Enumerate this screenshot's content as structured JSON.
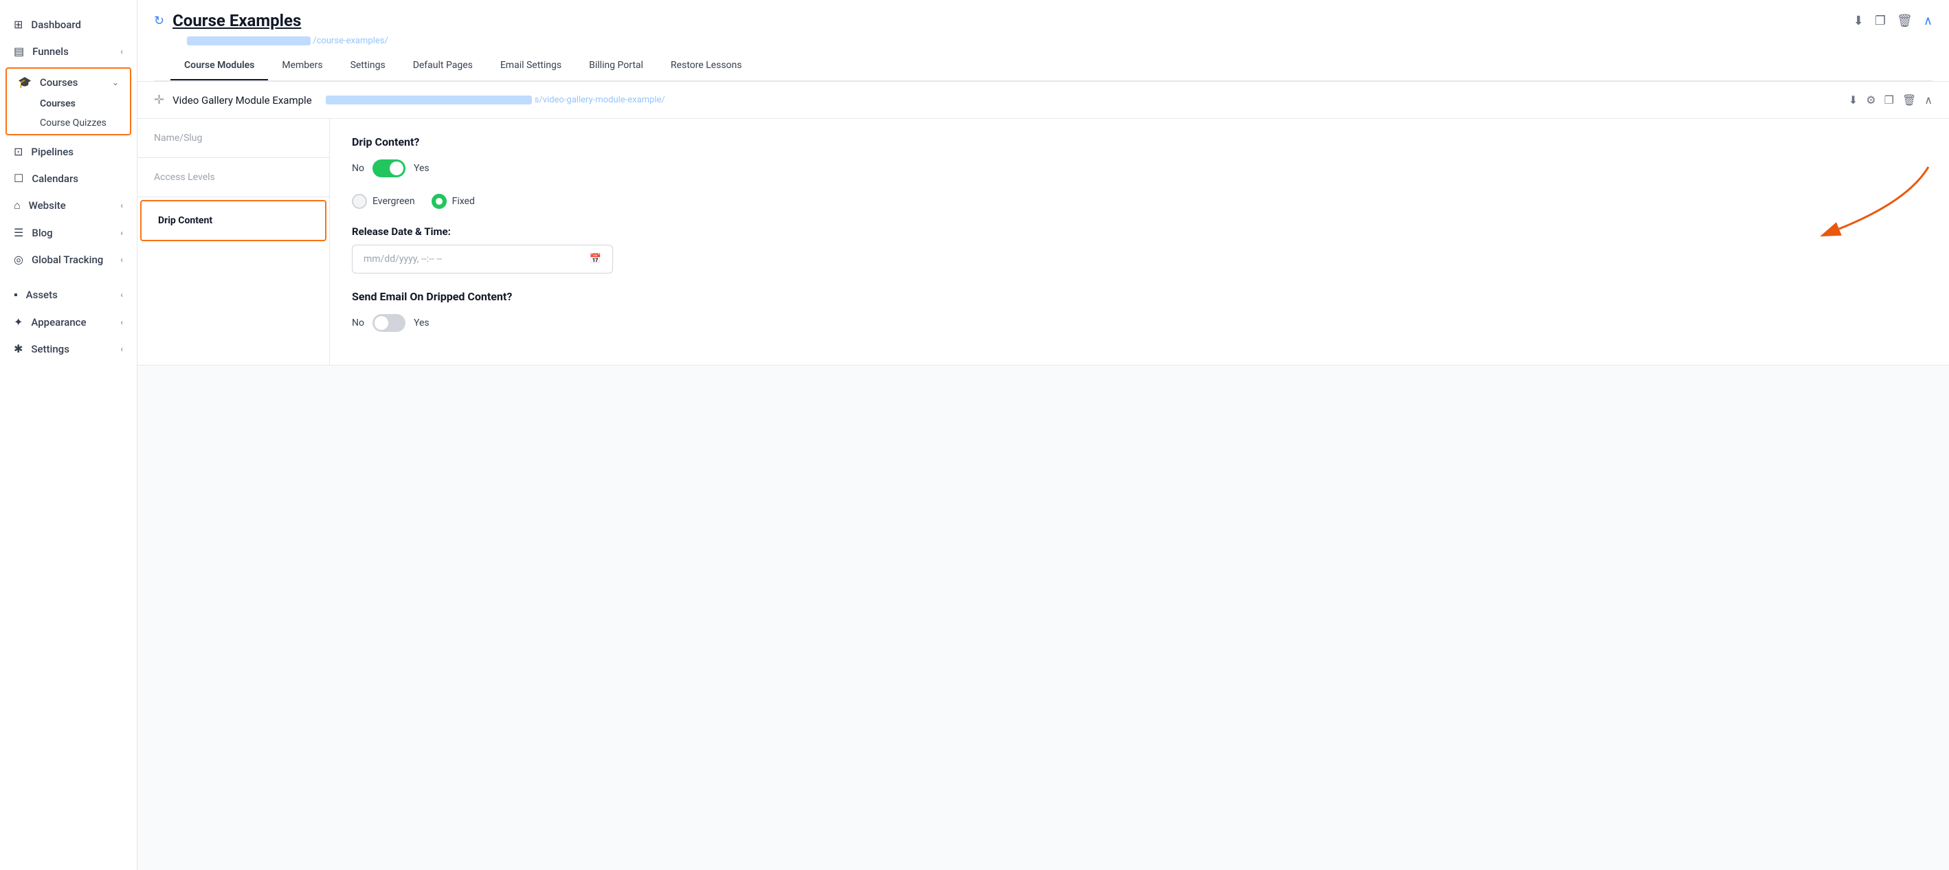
{
  "sidebar": {
    "items": [
      {
        "id": "dashboard",
        "label": "Dashboard",
        "icon": "⊞"
      },
      {
        "id": "funnels",
        "label": "Funnels",
        "icon": "▤",
        "chevron": "‹"
      },
      {
        "id": "courses",
        "label": "Courses",
        "icon": "🎓",
        "chevron": "⌄",
        "active": true
      },
      {
        "id": "courses-sub",
        "label": "Courses",
        "sub": true,
        "active": true
      },
      {
        "id": "course-quizzes",
        "label": "Course Quizzes",
        "sub": true
      },
      {
        "id": "pipelines",
        "label": "Pipelines",
        "icon": "⊡"
      },
      {
        "id": "calendars",
        "label": "Calendars",
        "icon": "☐"
      },
      {
        "id": "website",
        "label": "Website",
        "icon": "⌂",
        "chevron": "‹"
      },
      {
        "id": "blog",
        "label": "Blog",
        "icon": "☰",
        "chevron": "‹"
      },
      {
        "id": "global-tracking",
        "label": "Global Tracking",
        "icon": "◎",
        "chevron": "‹"
      },
      {
        "id": "assets",
        "label": "Assets",
        "icon": "▪",
        "chevron": "‹"
      },
      {
        "id": "appearance",
        "label": "Appearance",
        "icon": "✦",
        "chevron": "‹"
      },
      {
        "id": "settings",
        "label": "Settings",
        "icon": "✱",
        "chevron": "‹"
      }
    ]
  },
  "header": {
    "title": "Course Examples",
    "url_part1": "████████████████████████",
    "url_part2": "/course-examples/",
    "refresh_icon": "↻",
    "actions": [
      "⬇",
      "❐",
      "🗑"
    ]
  },
  "tabs": [
    {
      "id": "course-modules",
      "label": "Course Modules",
      "active": true
    },
    {
      "id": "members",
      "label": "Members"
    },
    {
      "id": "settings",
      "label": "Settings"
    },
    {
      "id": "default-pages",
      "label": "Default Pages"
    },
    {
      "id": "email-settings",
      "label": "Email Settings"
    },
    {
      "id": "billing-portal",
      "label": "Billing Portal"
    },
    {
      "id": "restore-lessons",
      "label": "Restore Lessons"
    }
  ],
  "module": {
    "title": "Video Gallery Module Example",
    "url_blur1": "████████████████",
    "url_part": "s/video-gallery-module-example/",
    "actions": [
      "⬇",
      "⚙",
      "❐",
      "🗑",
      "∧"
    ]
  },
  "left_panel": {
    "items": [
      {
        "id": "name-slug",
        "label": "Name/Slug"
      },
      {
        "id": "access-levels",
        "label": "Access Levels"
      },
      {
        "id": "drip-content",
        "label": "Drip Content",
        "active": true
      }
    ]
  },
  "right_panel": {
    "drip_content": {
      "title": "Drip Content?",
      "toggle_no": "No",
      "toggle_yes": "Yes",
      "toggle_checked": true,
      "radio_options": [
        {
          "id": "evergreen",
          "label": "Evergreen",
          "checked": false
        },
        {
          "id": "fixed",
          "label": "Fixed",
          "checked": true
        }
      ],
      "release_date_label": "Release Date & Time:",
      "date_placeholder": "mm/dd/yyyy, --:--  --",
      "send_email_title": "Send Email On Dripped Content?",
      "send_email_no": "No",
      "send_email_yes": "Yes",
      "send_email_checked": false
    }
  }
}
